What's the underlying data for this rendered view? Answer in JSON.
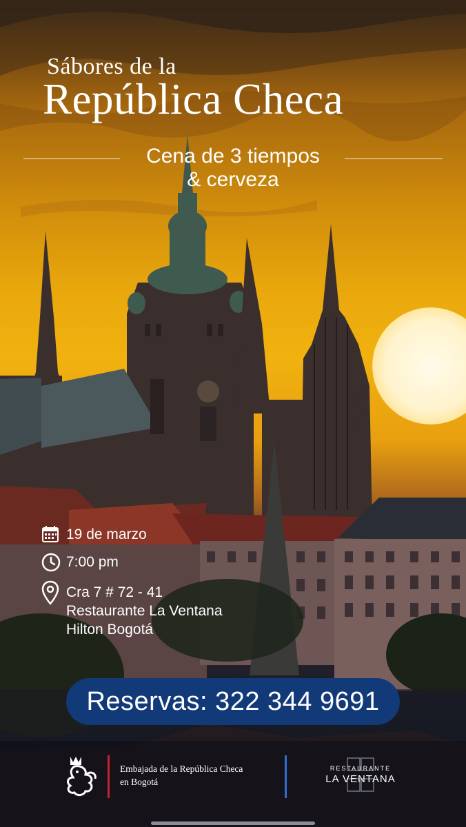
{
  "title": {
    "line1": "Sábores de la",
    "line2": "República Checa"
  },
  "subtitle": {
    "line1": "Cena de 3 tiempos",
    "line2": "& cerveza"
  },
  "details": {
    "date": "19 de marzo",
    "time": "7:00 pm",
    "address": "Cra 7 # 72 - 41",
    "venue": "Restaurante La Ventana",
    "hotel": "Hilton Bogotá"
  },
  "reservation": {
    "label": "Reservas: 322 344 9691"
  },
  "footer": {
    "embassy_line1": "Embajada de la República Checa",
    "embassy_line2": "en Bogotá",
    "restaurant_small": "RESTAURANTE",
    "restaurant_big": "LA VENTANA"
  },
  "colors": {
    "button": "#123a78",
    "sky_gold": "#f1b20f",
    "red_bar": "#c8212e",
    "blue_bar": "#2f6fd6"
  },
  "icons": [
    "calendar-icon",
    "clock-icon",
    "location-pin-icon",
    "czech-lion-emblem"
  ]
}
